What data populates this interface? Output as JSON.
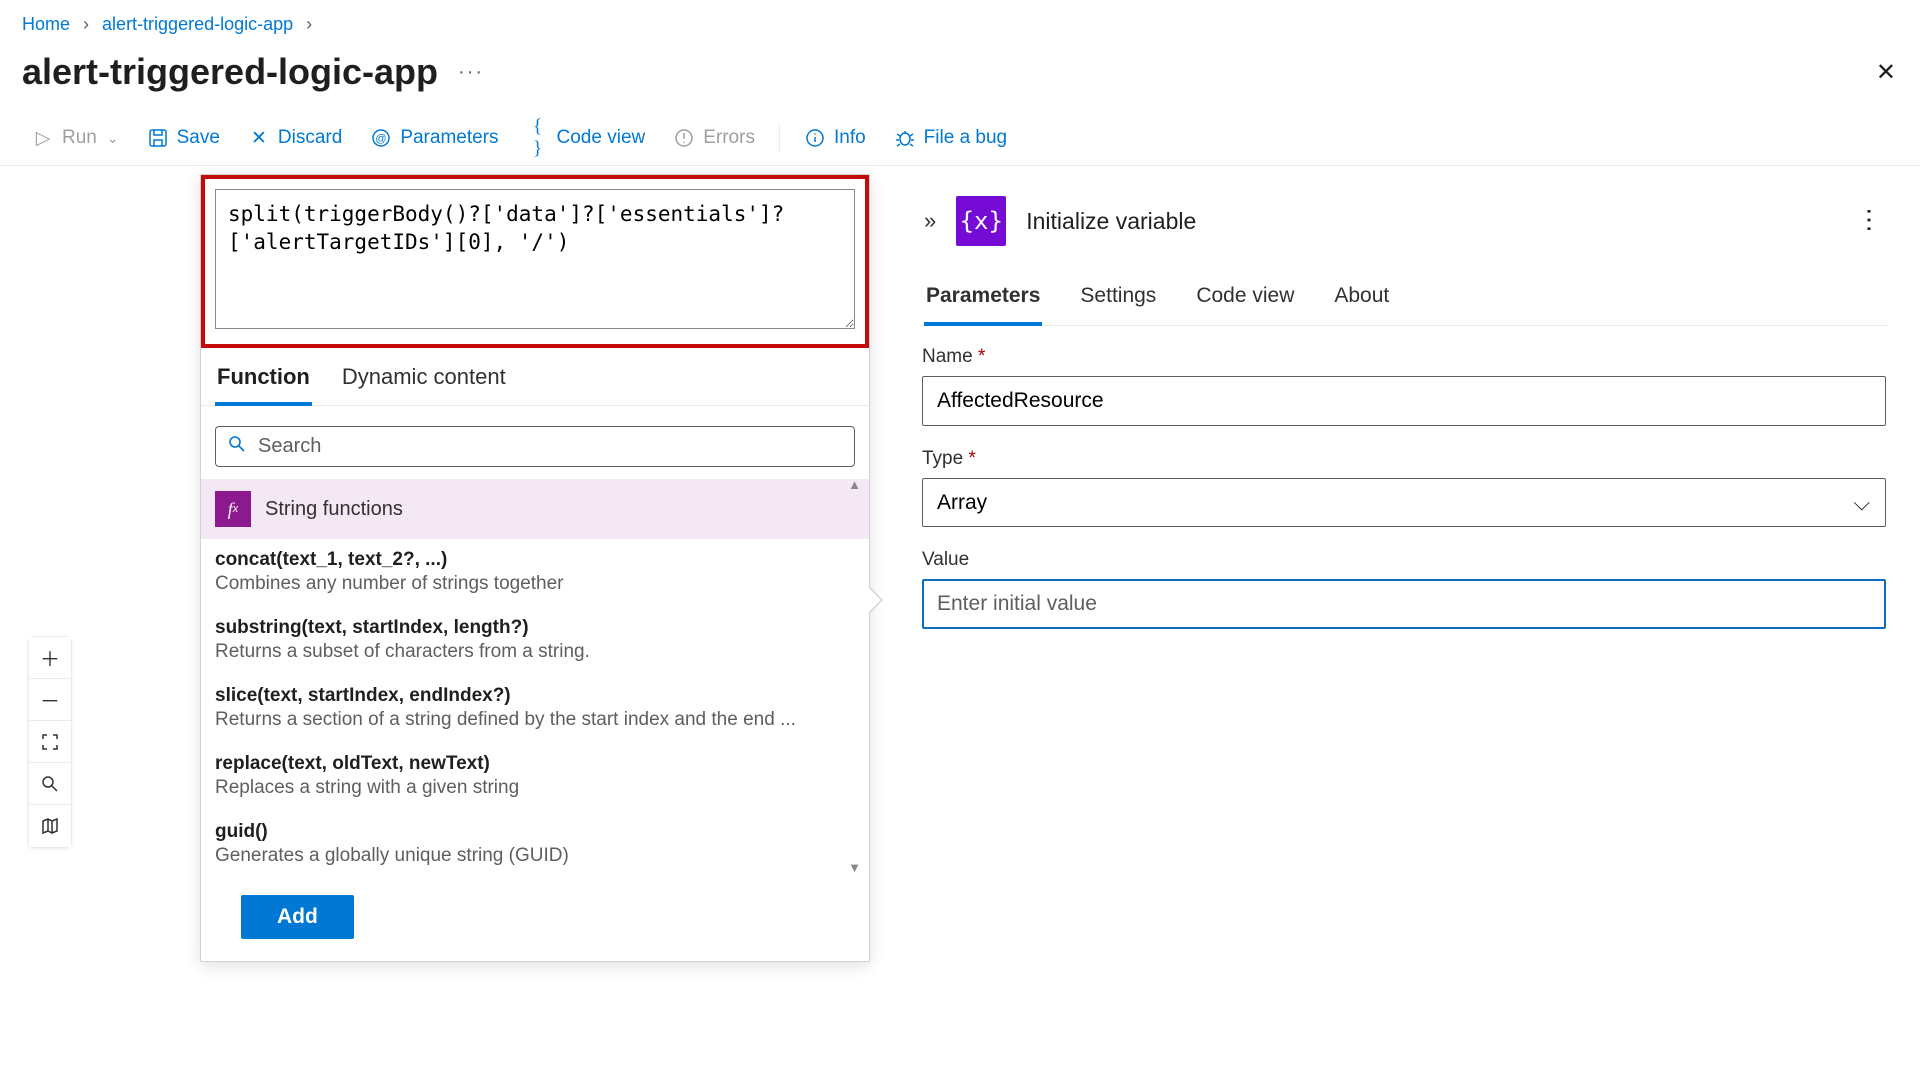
{
  "breadcrumb": {
    "home": "Home",
    "parent": "alert-triggered-logic-app"
  },
  "page": {
    "title": "alert-triggered-logic-app"
  },
  "toolbar": {
    "run": "Run",
    "save": "Save",
    "discard": "Discard",
    "parameters": "Parameters",
    "codeview": "Code view",
    "errors": "Errors",
    "info": "Info",
    "filebug": "File a bug"
  },
  "expression": {
    "code": "split(triggerBody()?['data']?['essentials']?['alertTargetIDs'][0], '/')",
    "tabs": {
      "function": "Function",
      "dynamic": "Dynamic content"
    },
    "search_placeholder": "Search",
    "category": "String functions",
    "functions": [
      {
        "sig": "concat(text_1, text_2?, ...)",
        "desc": "Combines any number of strings together"
      },
      {
        "sig": "substring(text, startIndex, length?)",
        "desc": "Returns a subset of characters from a string."
      },
      {
        "sig": "slice(text, startIndex, endIndex?)",
        "desc": "Returns a section of a string defined by the start index and the end ..."
      },
      {
        "sig": "replace(text, oldText, newText)",
        "desc": "Replaces a string with a given string"
      },
      {
        "sig": "guid()",
        "desc": "Generates a globally unique string (GUID)"
      }
    ],
    "add": "Add"
  },
  "props": {
    "action_title": "Initialize variable",
    "tabs": {
      "parameters": "Parameters",
      "settings": "Settings",
      "codeview": "Code view",
      "about": "About"
    },
    "name_label": "Name",
    "name_value": "AffectedResource",
    "type_label": "Type",
    "type_value": "Array",
    "value_label": "Value",
    "value_placeholder": "Enter initial value"
  }
}
